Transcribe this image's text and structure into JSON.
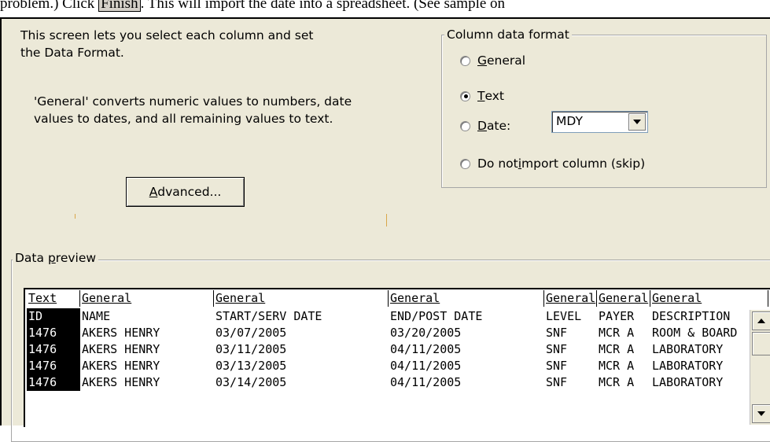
{
  "doc_text": {
    "before": "problem.) Click ",
    "button_ref": "Finish",
    "after": ". This will import the date into a spreadsheet. (See sample on"
  },
  "dialog": {
    "description_line1": "This screen lets you select each column and set",
    "description_line2": "the Data Format.",
    "general_note_line1": "'General' converts numeric values to numbers, date",
    "general_note_line2": "values to dates, and all remaining values to text.",
    "advanced_button": "Advanced...",
    "column_format": {
      "title": "Column data format",
      "options": [
        {
          "key": "G",
          "rest": "eneral",
          "prefix": "",
          "checked": false
        },
        {
          "key": "T",
          "rest": "ext",
          "prefix": "",
          "checked": true
        },
        {
          "key": "D",
          "rest": "ate:",
          "prefix": "",
          "checked": false
        },
        {
          "prefix": "Do not ",
          "key": "i",
          "rest": "mport column (skip)",
          "checked": false
        }
      ],
      "date_format_value": "MDY"
    },
    "data_preview": {
      "title_prefix": "Data ",
      "title_key": "p",
      "title_rest": "review",
      "headers": [
        "Text",
        "General",
        "General",
        "General",
        "General",
        "General",
        "General"
      ],
      "rows": [
        [
          "ID",
          "NAME",
          "START/SERV DATE",
          "END/POST DATE",
          "LEVEL",
          "PAYER",
          "DESCRIPTION"
        ],
        [
          "1476",
          "AKERS HENRY",
          "03/07/2005",
          "03/20/2005",
          "SNF",
          "MCR A",
          "ROOM & BOARD"
        ],
        [
          "1476",
          "AKERS HENRY",
          "03/11/2005",
          "04/11/2005",
          "SNF",
          "MCR A",
          "LABORATORY"
        ],
        [
          "1476",
          "AKERS HENRY",
          "03/13/2005",
          "04/11/2005",
          "SNF",
          "MCR A",
          "LABORATORY"
        ],
        [
          "1476",
          "AKERS HENRY",
          "03/14/2005",
          "04/11/2005",
          "SNF",
          "MCR A",
          "LABORATORY"
        ]
      ]
    }
  }
}
